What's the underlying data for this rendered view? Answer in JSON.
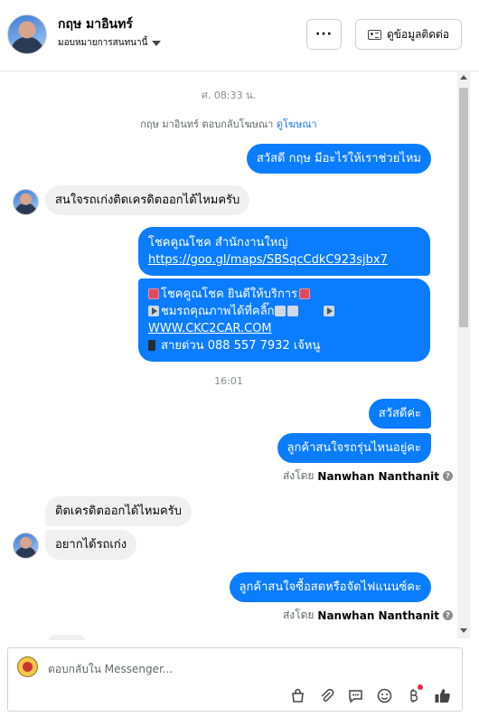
{
  "header": {
    "name": "กฤษ มาอินทร์",
    "assignee": "มอบหมายการสนทนานี้",
    "more_label": "···",
    "contact_label": "ดูข้อมูลติดต่อ"
  },
  "timestamps": {
    "first": "ศ. 08:33 น.",
    "second": "16:01"
  },
  "ad_reply": {
    "text": "กฤษ มาอินทร์ ตอบกลับโฆษณา",
    "link": "ดูโฆษณา"
  },
  "messages": {
    "m1": "สวัสดี กฤษ มีอะไรให้เราช่วยไหม",
    "m2": "สนใจรถเก่งติดเครดิตออกได้ไหมครับ",
    "m3_line1": "โชคคูณโชค สำนักงานใหญ่",
    "m3_link": "https://goo.gl/maps/SBSqcCdkC923sjbx7",
    "m4_line1": "โชคคูณโชค ยินดีให้บริการ",
    "m4_line2": "ชมรถคุณภาพได้ที่คลิ๊ก",
    "m4_link": "WWW.CKC2CAR.COM",
    "m4_line4": "สายด่วน 088 557 7932 เจ้หนู",
    "m5": "สวัสดีค่ะ",
    "m6": "ลูกค้าสนใจรถรุ่นไหนอยู่คะ",
    "m7": "ติดเครดิตออกได้ไหมครับ",
    "m8": "อยากได้รถเก่ง",
    "m9": "ลูกค้าสนใจซื้อสดหรือจัดไฟแนนซ์คะ"
  },
  "sent_by": {
    "prefix": "ส่งโดย",
    "name": "Nanwhan Nanthanit",
    "help": "?"
  },
  "composer": {
    "placeholder": "ตอบกลับใน Messenger...",
    "icons": [
      "shopping-bag-icon",
      "paperclip-icon",
      "saved-replies-icon",
      "emoji-icon",
      "payment-icon",
      "like-icon"
    ]
  }
}
